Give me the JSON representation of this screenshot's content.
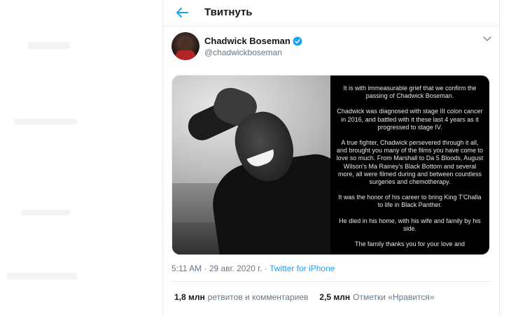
{
  "header": {
    "title": "Твитнуть",
    "back_icon": "arrow-left-icon"
  },
  "author": {
    "display_name": "Chadwick Boseman",
    "handle": "@chadwickboseman",
    "verified_icon": "verified-badge-icon",
    "menu_icon": "chevron-down-icon"
  },
  "media": {
    "statement_paragraphs": [
      "It is with immeasurable grief that we confirm the passing of Chadwick Boseman.",
      "Chadwick was diagnosed with stage III colon cancer in 2016, and battled with it these last 4 years as it progressed to stage IV.",
      "A true fighter, Chadwick persevered through it all, and brought you many of the films you have come to love so much. From Marshall to Da 5 Bloods, August Wilson's Ma Rainey's Black Bottom and several more, all were filmed during and between countless surgeries and chemotherapy.",
      "It was the honor of his career to bring King T'Challa to life in Black Panther.",
      "He died in his home, with his wife and family by his side.",
      "The family thanks you for your love and"
    ]
  },
  "meta": {
    "time": "5:11 AM",
    "separator": " · ",
    "date": "29 авг. 2020 г.",
    "source_separator": " · ",
    "source": "Twitter for iPhone"
  },
  "stats": {
    "retweets_count": "1,8 млн",
    "retweets_label": "ретвитов и комментариев",
    "likes_count": "2,5 млн",
    "likes_label": "Отметки «Нравится»"
  },
  "colors": {
    "accent": "#1da1f2",
    "secondary_text": "#657786",
    "border": "#e6ecf0"
  }
}
